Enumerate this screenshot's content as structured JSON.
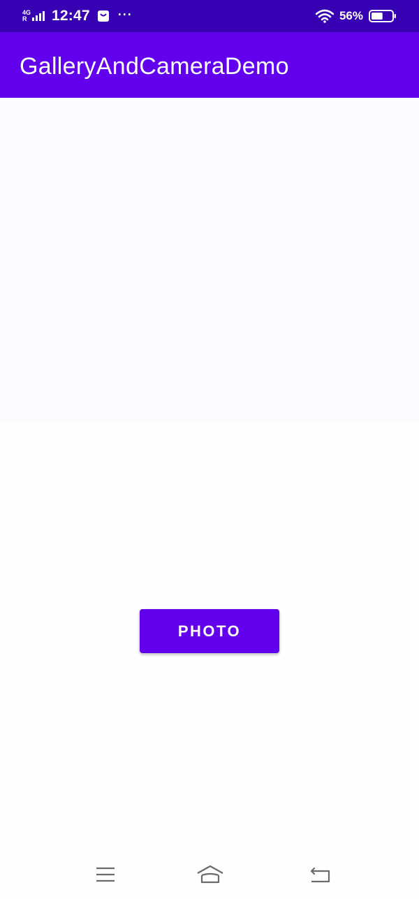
{
  "status_bar": {
    "network_type_top": "4G",
    "network_type_bottom": "R",
    "time": "12:47",
    "notification_icon": "bag-icon",
    "more_indicator": "···",
    "wifi_icon": "wifi-icon",
    "battery_percent": "56%",
    "battery_level": 0.56,
    "background_color": "#3700b3"
  },
  "app_bar": {
    "title": "GalleryAndCameraDemo",
    "background_color": "#6200ee"
  },
  "main": {
    "image_view_placeholder": "",
    "photo_button_label": "PHOTO",
    "button_color": "#6200ee"
  },
  "nav_bar": {
    "menu_icon": "menu-icon",
    "home_icon": "home-icon",
    "back_icon": "back-icon"
  }
}
